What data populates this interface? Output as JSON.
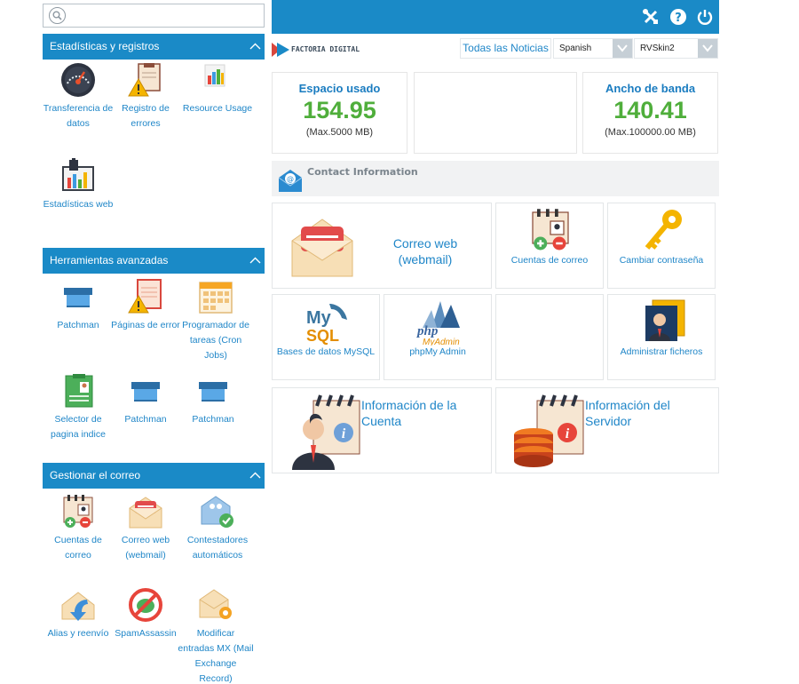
{
  "search": {
    "placeholder": ""
  },
  "sections": {
    "stats": {
      "title": "Estadísticas y registros"
    },
    "advanced": {
      "title": "Herramientas avanzadas"
    },
    "mail": {
      "title": "Gestionar el correo"
    }
  },
  "stats_tiles": [
    {
      "label": "Transferencia de datos",
      "icon": "gauge-icon"
    },
    {
      "label": "Registro de errores",
      "icon": "error-log-icon"
    },
    {
      "label": "Resource Usage",
      "icon": "bar-chart-icon"
    },
    {
      "label": "Estadísticas web",
      "icon": "web-stats-icon"
    }
  ],
  "advanced_tiles": [
    {
      "label": "Patchman",
      "icon": "box-icon"
    },
    {
      "label": "Páginas de error",
      "icon": "error-page-icon"
    },
    {
      "label": "Programador de tareas (Cron Jobs)",
      "icon": "calendar-icon"
    },
    {
      "label": "Selector de pagina indice",
      "icon": "index-selector-icon"
    },
    {
      "label": "Patchman",
      "icon": "box-icon"
    },
    {
      "label": "Patchman",
      "icon": "box-icon"
    }
  ],
  "mail_tiles": [
    {
      "label": "Cuentas de correo",
      "icon": "mail-accounts-icon"
    },
    {
      "label": "Correo web (webmail)",
      "icon": "envelope-icon"
    },
    {
      "label": "Contestadores automáticos",
      "icon": "autoresponder-icon"
    },
    {
      "label": "Alias y reenvío",
      "icon": "forward-icon"
    },
    {
      "label": "SpamAssassin",
      "icon": "spam-icon"
    },
    {
      "label": "Modificar entradas MX (Mail Exchange Record)",
      "icon": "mx-record-icon"
    }
  ],
  "topbar": {
    "icons": [
      "tools-icon",
      "help-icon",
      "power-icon"
    ]
  },
  "brand": {
    "name": "FACTORIA DIGITAL"
  },
  "news_button": "Todas las Noticias",
  "language": "Spanish",
  "skin": "RVSkin2",
  "stat_disk": {
    "title": "Espacio usado",
    "value": "154.95",
    "sub": "(Max.5000 MB)"
  },
  "stat_bandwidth": {
    "title": "Ancho de banda",
    "value": "140.41",
    "sub": "(Max.100000.00 MB)"
  },
  "contact": {
    "label": "Contact Information"
  },
  "cards": {
    "webmail": "Correo web (webmail)",
    "mail_accounts": "Cuentas de correo",
    "change_password": "Cambiar contraseña",
    "mysql": "Bases de datos MySQL",
    "phpmyadmin": "phpMy Admin",
    "file_manager": "Administrar ficheros",
    "account_info": "Información de la Cuenta",
    "server_info": "Información del Servidor"
  },
  "colors": {
    "accent": "#1a8ac7",
    "value_green": "#4fae3b",
    "link": "#1f86c8"
  }
}
